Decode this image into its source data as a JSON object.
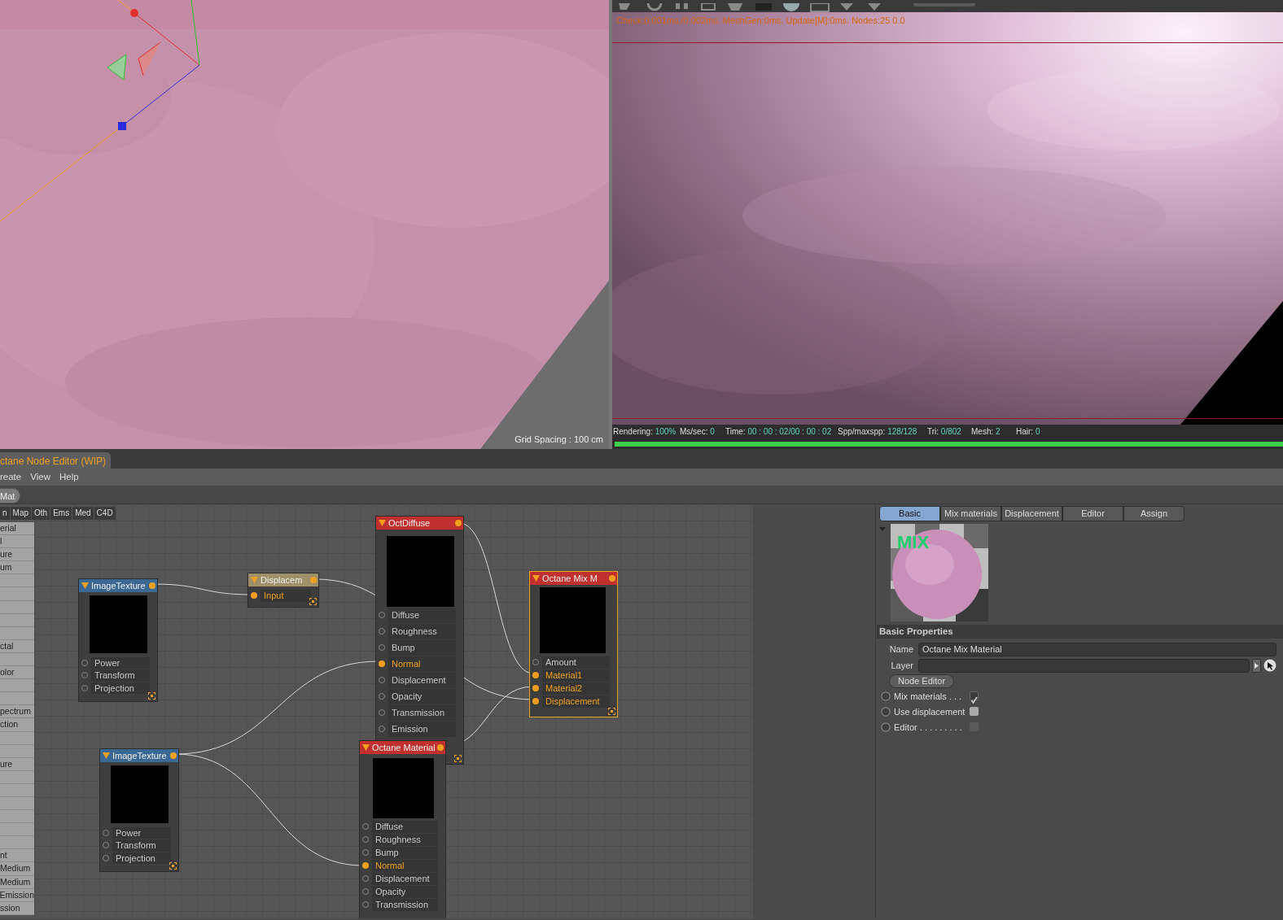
{
  "viewport": {
    "kind": "picture",
    "grid_spacing": "Grid Spacing : 100 cm"
  },
  "render_view": {
    "kind": "picture",
    "stats_overlay": "Check:0.001ms./0.002ms. MeshGen:0ms. Update[M]:0ms. Nodes:25  0.0",
    "status": [
      {
        "label": "Rendering:",
        "value": "100%"
      },
      {
        "label": "Ms/sec:",
        "value": "0"
      },
      {
        "label": "Time:",
        "value": "00 : 00 : 02/00 : 00 : 02"
      },
      {
        "label": "Spp/maxspp:",
        "value": "128/128"
      },
      {
        "label": "Tri:",
        "value": "0/802"
      },
      {
        "label": "Mesh:",
        "value": "2"
      },
      {
        "label": "Hair:",
        "value": "0"
      }
    ],
    "progress": {
      "level": 1
    }
  },
  "node_editor": {
    "tab": "ctane Node Editor (WIP)",
    "menu": [
      "reate",
      "View",
      "Help"
    ],
    "toolbar_button": "Mat",
    "category_tabs": [
      "n",
      "Map",
      "Oth",
      "Ems",
      "Med",
      "C4D"
    ],
    "category_list": [
      {
        "kind": "item",
        "label": "erial"
      },
      {
        "kind": "item",
        "label": "l"
      },
      {
        "kind": "item",
        "label": "ure"
      },
      {
        "kind": "item",
        "label": "um"
      },
      {
        "kind": "blank"
      },
      {
        "kind": "blank"
      },
      {
        "kind": "blank"
      },
      {
        "kind": "blank"
      },
      {
        "kind": "blank"
      },
      {
        "kind": "item",
        "label": "ctal"
      },
      {
        "kind": "blank"
      },
      {
        "kind": "item",
        "label": "olor"
      },
      {
        "kind": "blank"
      },
      {
        "kind": "blank"
      },
      {
        "kind": "item",
        "label": "pectrum"
      },
      {
        "kind": "item",
        "label": "ction"
      },
      {
        "kind": "blank"
      },
      {
        "kind": "blank"
      },
      {
        "kind": "item",
        "label": "ure"
      },
      {
        "kind": "blank"
      },
      {
        "kind": "blank"
      },
      {
        "kind": "blank"
      },
      {
        "kind": "blank"
      },
      {
        "kind": "blank"
      },
      {
        "kind": "blank"
      },
      {
        "kind": "item",
        "label": "nt"
      },
      {
        "kind": "item",
        "label": "Medium"
      },
      {
        "kind": "item",
        "label": "Medium"
      },
      {
        "kind": "item",
        "label": "Emission"
      },
      {
        "kind": "item",
        "label": "ssion"
      }
    ],
    "nodes": [
      {
        "title": "ImageTexture",
        "kind": "texture",
        "selected": false,
        "ports": [
          {
            "label": "Power",
            "connected": false
          },
          {
            "label": "Transform",
            "connected": false
          },
          {
            "label": "Projection",
            "connected": false
          }
        ]
      },
      {
        "title": "Displacem",
        "kind": "displacement",
        "selected": false,
        "ports": [
          {
            "label": "Input",
            "connected": true
          }
        ]
      },
      {
        "title": "OctDiffuse",
        "kind": "material",
        "selected": false,
        "ports": [
          {
            "label": "Diffuse",
            "connected": false
          },
          {
            "label": "Roughness",
            "connected": false
          },
          {
            "label": "Bump",
            "connected": false
          },
          {
            "label": "Normal",
            "connected": true
          },
          {
            "label": "Displacement",
            "connected": false
          },
          {
            "label": "Opacity",
            "connected": false
          },
          {
            "label": "Transmission",
            "connected": false
          },
          {
            "label": "Emission",
            "connected": false
          }
        ]
      },
      {
        "title": "Octane Mix M",
        "kind": "material",
        "selected": true,
        "ports": [
          {
            "label": "Amount",
            "connected": false
          },
          {
            "label": "Material1",
            "connected": true
          },
          {
            "label": "Material2",
            "connected": true
          },
          {
            "label": "Displacement",
            "connected": true
          }
        ]
      },
      {
        "title": "ImageTexture",
        "kind": "texture",
        "selected": false,
        "ports": [
          {
            "label": "Power",
            "connected": false
          },
          {
            "label": "Transform",
            "connected": false
          },
          {
            "label": "Projection",
            "connected": false
          }
        ]
      },
      {
        "title": "Octane Material",
        "kind": "material",
        "selected": false,
        "ports": [
          {
            "label": "Diffuse",
            "connected": false
          },
          {
            "label": "Roughness",
            "connected": false
          },
          {
            "label": "Bump",
            "connected": false
          },
          {
            "label": "Normal",
            "connected": true
          },
          {
            "label": "Displacement",
            "connected": false
          },
          {
            "label": "Opacity",
            "connected": false
          },
          {
            "label": "Transmission",
            "connected": false
          }
        ]
      }
    ]
  },
  "attributes": {
    "tabs": [
      {
        "label": "Basic",
        "selected": true
      },
      {
        "label": "Mix materials",
        "selected": false
      },
      {
        "label": "Displacement",
        "selected": false
      },
      {
        "label": "Editor",
        "selected": false
      },
      {
        "label": "Assign",
        "selected": false
      }
    ],
    "preview": {
      "kind": "picture",
      "label": "MIX"
    },
    "section": "Basic Properties",
    "name_field": {
      "label": "Name",
      "value": "Octane Mix Material"
    },
    "layer_field": {
      "label": "Layer"
    },
    "node_editor_button": "Node Editor",
    "options": [
      {
        "label": "Mix materials . . .",
        "checked": true,
        "disabled": false
      },
      {
        "label": "Use displacement",
        "checked": false,
        "disabled": false
      },
      {
        "label": "Editor . . . . . . . . .",
        "checked": false,
        "disabled": true
      }
    ]
  }
}
